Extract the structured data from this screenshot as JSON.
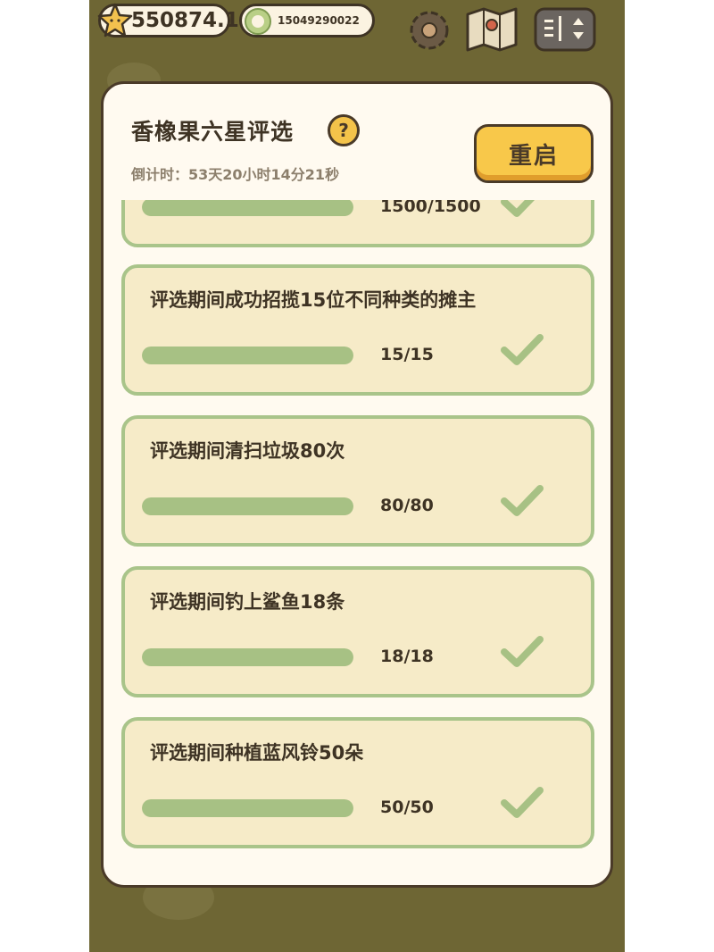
{
  "hud": {
    "stars_value": "550874.1",
    "coins_value": "15049290022",
    "icons": [
      "star-icon",
      "coin-icon",
      "gear-icon",
      "map-icon",
      "menu-toggle-icon"
    ]
  },
  "modal": {
    "title": "香橡果六星评选",
    "countdown": "倒计时：53天20小时14分21秒",
    "restart_label": "重启",
    "help_icon": "?"
  },
  "tasks": [
    {
      "title": "",
      "progress_text": "1500/1500",
      "progress": 1.0,
      "done": true
    },
    {
      "title": "评选期间成功招揽15位不同种类的摊主",
      "progress_text": "15/15",
      "progress": 1.0,
      "done": true
    },
    {
      "title": "评选期间清扫垃圾80次",
      "progress_text": "80/80",
      "progress": 1.0,
      "done": true
    },
    {
      "title": "评选期间钓上鲨鱼18条",
      "progress_text": "18/18",
      "progress": 1.0,
      "done": true
    },
    {
      "title": "评选期间种植蓝风铃50朵",
      "progress_text": "50/50",
      "progress": 1.0,
      "done": true
    }
  ],
  "colors": {
    "accent_button": "#f8c84a",
    "card_border": "#a9c48a",
    "progress_fill": "#a7c184",
    "check": "#a7c184"
  }
}
